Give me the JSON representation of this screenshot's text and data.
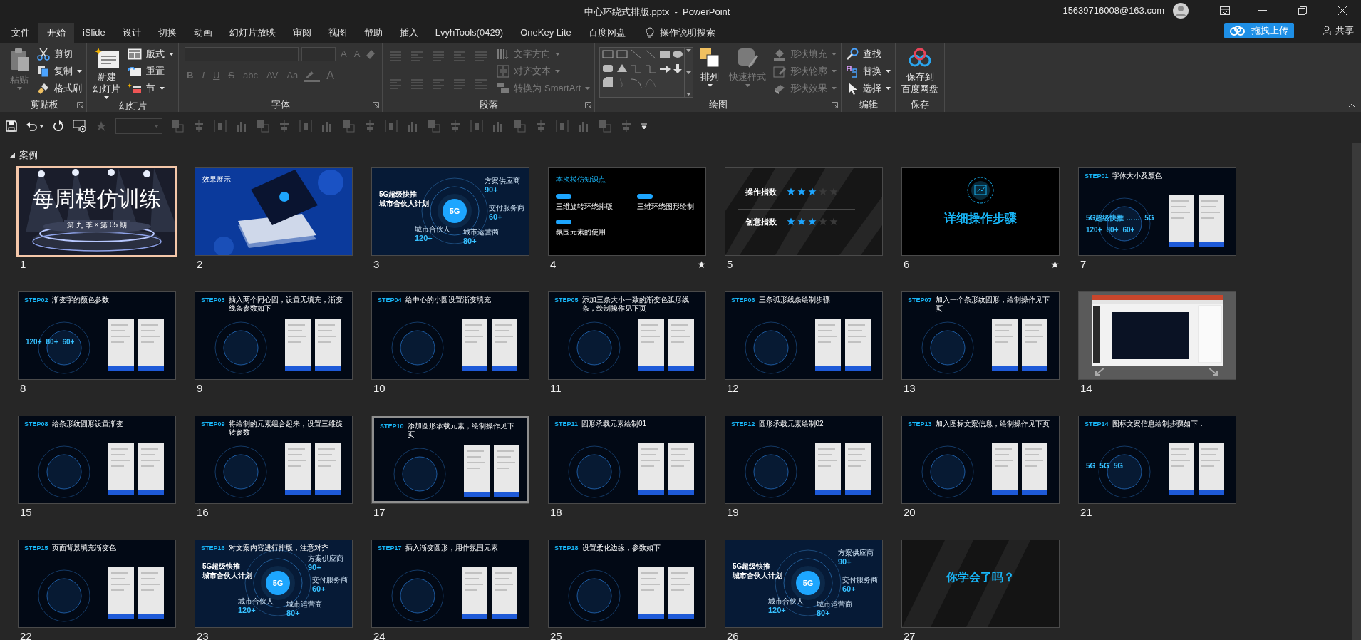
{
  "window": {
    "title": "中心环绕式排版.pptx  -  PowerPoint",
    "account": "15639716008@163.com"
  },
  "menu_tabs": [
    {
      "label": "文件",
      "selected": false
    },
    {
      "label": "开始",
      "selected": true
    },
    {
      "label": "iSlide",
      "selected": false
    },
    {
      "label": "设计",
      "selected": false
    },
    {
      "label": "切换",
      "selected": false
    },
    {
      "label": "动画",
      "selected": false
    },
    {
      "label": "幻灯片放映",
      "selected": false
    },
    {
      "label": "审阅",
      "selected": false
    },
    {
      "label": "视图",
      "selected": false
    },
    {
      "label": "帮助",
      "selected": false
    },
    {
      "label": "插入",
      "selected": false
    },
    {
      "label": "LvyhTools(0429)",
      "selected": false
    },
    {
      "label": "OneKey Lite",
      "selected": false
    },
    {
      "label": "百度网盘",
      "selected": false
    }
  ],
  "tell_me": "操作说明搜索",
  "upload_button": "拖拽上传",
  "share_button": "共享",
  "ribbon": [
    {
      "name": "剪贴板",
      "launcher": true,
      "items": [
        {
          "kind": "large",
          "label_lines": [
            "粘贴"
          ],
          "disabled": true,
          "dropdown": true
        },
        {
          "kind": "small",
          "label": "剪切",
          "disabled": false,
          "dropdown": false
        },
        {
          "kind": "small",
          "label": "复制",
          "disabled": false,
          "dropdown": true
        },
        {
          "kind": "small",
          "label": "格式刷",
          "disabled": false,
          "dropdown": false
        }
      ]
    },
    {
      "name": "幻灯片",
      "launcher": false,
      "items": [
        {
          "kind": "large",
          "label_lines": [
            "新建",
            "幻灯片"
          ],
          "disabled": false,
          "dropdown": true
        },
        {
          "kind": "small",
          "label": "版式",
          "disabled": false,
          "dropdown": true
        },
        {
          "kind": "small",
          "label": "重置",
          "disabled": false,
          "dropdown": false
        },
        {
          "kind": "small",
          "label": "节",
          "disabled": false,
          "dropdown": true
        }
      ]
    },
    {
      "name": "字体",
      "launcher": true,
      "items": [
        {
          "kind": "font_tools",
          "disabled": true,
          "top_buttons": [
            "A",
            "A"
          ],
          "buttons": [
            "B",
            "I",
            "U",
            "S",
            "abc",
            "AV",
            "Aa"
          ],
          "color_button": "A"
        }
      ]
    },
    {
      "name": "段落",
      "launcher": true,
      "items": [
        {
          "kind": "paragraph_tools",
          "disabled": true
        },
        {
          "kind": "small",
          "label": "文字方向",
          "disabled": true,
          "dropdown": true
        },
        {
          "kind": "small",
          "label": "对齐文本",
          "disabled": true,
          "dropdown": true
        },
        {
          "kind": "small",
          "label": "转换为 SmartArt",
          "disabled": true,
          "dropdown": true
        }
      ]
    },
    {
      "name": "绘图",
      "launcher": true,
      "items": [
        {
          "kind": "shape_gallery",
          "disabled": false
        },
        {
          "kind": "large",
          "label_lines": [
            "排列"
          ],
          "disabled": false,
          "dropdown": true
        },
        {
          "kind": "large",
          "label_lines": [
            "快速样式"
          ],
          "disabled": true,
          "dropdown": true
        },
        {
          "kind": "small",
          "label": "形状填充",
          "disabled": true,
          "dropdown": true
        },
        {
          "kind": "small",
          "label": "形状轮廓",
          "disabled": true,
          "dropdown": true
        },
        {
          "kind": "small",
          "label": "形状效果",
          "disabled": true,
          "dropdown": true
        }
      ]
    },
    {
      "name": "编辑",
      "launcher": false,
      "items": [
        {
          "kind": "small",
          "label": "查找",
          "disabled": false,
          "dropdown": false
        },
        {
          "kind": "small",
          "label": "替换",
          "disabled": false,
          "dropdown": true
        },
        {
          "kind": "small",
          "label": "选择",
          "disabled": false,
          "dropdown": true
        }
      ]
    },
    {
      "name": "保存",
      "launcher": false,
      "items": [
        {
          "kind": "large",
          "label_lines": [
            "保存到",
            "百度网盘"
          ],
          "disabled": false,
          "dropdown": false
        }
      ]
    }
  ],
  "section": {
    "name": "案例",
    "expanded": true
  },
  "slides": [
    {
      "number": "1",
      "selected": true,
      "focused": false,
      "animated": false,
      "kind": "cover",
      "title": "每周模仿训练",
      "subtitle": "第 九 季 × 第 05 期"
    },
    {
      "number": "2",
      "selected": false,
      "focused": false,
      "animated": false,
      "title": "效果展示"
    },
    {
      "number": "3",
      "selected": false,
      "focused": false,
      "animated": false,
      "kind": "hero",
      "title_lines": [
        "5G超级快推",
        "城市合伙人计划"
      ],
      "badge": "5G",
      "metrics": [
        {
          "label": "方案供应商",
          "value": "90+"
        },
        {
          "label": "交付服务商",
          "value": "60+"
        },
        {
          "label": "城市合伙人",
          "value": "120+"
        },
        {
          "label": "城市运营商",
          "value": "80+"
        }
      ]
    },
    {
      "number": "4",
      "selected": false,
      "focused": false,
      "animated": true,
      "kind": "points",
      "title": "本次模仿知识点",
      "points": [
        "三维旋转环绕排版",
        "三维环绕图形绘制",
        "氛围元素的使用"
      ]
    },
    {
      "number": "5",
      "selected": false,
      "focused": false,
      "animated": false,
      "kind": "rating",
      "ratings": [
        {
          "label": "操作指数",
          "stars": 3
        },
        {
          "label": "创意指数",
          "stars": 3
        }
      ]
    },
    {
      "number": "6",
      "selected": false,
      "focused": false,
      "animated": true,
      "kind": "section",
      "title": "详细操作步骤"
    },
    {
      "number": "7",
      "selected": false,
      "focused": false,
      "animated": false,
      "kind": "step",
      "step": "STEP01",
      "title": "字体大小及颜色",
      "texts": [
        "5G超级快推 ……",
        "5G",
        "120+",
        "80+",
        "60+"
      ]
    },
    {
      "number": "8",
      "selected": false,
      "focused": false,
      "animated": false,
      "kind": "step",
      "step": "STEP02",
      "title": "渐变字的颜色参数",
      "texts": [
        "120+",
        "80+",
        "60+"
      ]
    },
    {
      "number": "9",
      "selected": false,
      "focused": false,
      "animated": false,
      "kind": "step",
      "step": "STEP03",
      "title": "插入两个同心圆，设置无填充，渐变线条参数如下"
    },
    {
      "number": "10",
      "selected": false,
      "focused": false,
      "animated": false,
      "kind": "step",
      "step": "STEP04",
      "title": "给中心的小圆设置渐变填充"
    },
    {
      "number": "11",
      "selected": false,
      "focused": false,
      "animated": false,
      "kind": "step",
      "step": "STEP05",
      "title": "添加三条大小一致的渐变色弧形线条，绘制操作见下页"
    },
    {
      "number": "12",
      "selected": false,
      "focused": false,
      "animated": false,
      "kind": "step",
      "step": "STEP06",
      "title": "三条弧形线条绘制步骤"
    },
    {
      "number": "13",
      "selected": false,
      "focused": false,
      "animated": false,
      "kind": "step",
      "step": "STEP07",
      "title": "加入一个条形纹圆形，绘制操作见下页"
    },
    {
      "number": "14",
      "selected": false,
      "focused": false,
      "animated": false,
      "kind": "screenshot"
    },
    {
      "number": "15",
      "selected": false,
      "focused": false,
      "animated": false,
      "kind": "step",
      "step": "STEP08",
      "title": "给条形纹圆形设置渐变"
    },
    {
      "number": "16",
      "selected": false,
      "focused": false,
      "animated": false,
      "kind": "step",
      "step": "STEP09",
      "title": "将绘制的元素组合起来，设置三维旋转参数"
    },
    {
      "number": "17",
      "selected": false,
      "focused": true,
      "animated": false,
      "kind": "step",
      "step": "STEP10",
      "title": "添加圆形承载元素，绘制操作见下页"
    },
    {
      "number": "18",
      "selected": false,
      "focused": false,
      "animated": false,
      "kind": "step",
      "step": "STEP11",
      "title": "圆形承载元素绘制01"
    },
    {
      "number": "19",
      "selected": false,
      "focused": false,
      "animated": false,
      "kind": "step",
      "step": "STEP12",
      "title": "圆形承载元素绘制02"
    },
    {
      "number": "20",
      "selected": false,
      "focused": false,
      "animated": false,
      "kind": "step",
      "step": "STEP13",
      "title": "加入图标文案信息，绘制操作见下页"
    },
    {
      "number": "21",
      "selected": false,
      "focused": false,
      "animated": false,
      "kind": "step",
      "step": "STEP14",
      "title": "图标文案信息绘制步骤如下：",
      "texts": [
        "5G",
        "5G",
        "5G"
      ]
    },
    {
      "number": "22",
      "selected": false,
      "focused": false,
      "animated": false,
      "kind": "step",
      "step": "STEP15",
      "title": "页面背景填充渐变色"
    },
    {
      "number": "23",
      "selected": false,
      "focused": false,
      "animated": false,
      "kind": "hero",
      "step": "STEP16",
      "title": "对文案内容进行排版，注意对齐",
      "title_lines": [
        "5G超级快推",
        "城市合伙人计划"
      ],
      "badge": "5G",
      "metrics": [
        {
          "label": "方案供应商",
          "value": "90+"
        },
        {
          "label": "交付服务商",
          "value": "60+"
        },
        {
          "label": "城市合伙人",
          "value": "120+"
        },
        {
          "label": "城市运营商",
          "value": "80+"
        }
      ]
    },
    {
      "number": "24",
      "selected": false,
      "focused": false,
      "animated": false,
      "kind": "step",
      "step": "STEP17",
      "title": "插入渐变圆形，用作氛围元素"
    },
    {
      "number": "25",
      "selected": false,
      "focused": false,
      "animated": false,
      "kind": "step",
      "step": "STEP18",
      "title": "设置柔化边缘，参数如下"
    },
    {
      "number": "26",
      "selected": false,
      "focused": false,
      "animated": false,
      "kind": "hero",
      "title_lines": [
        "5G超级快推",
        "城市合伙人计划"
      ],
      "badge": "5G",
      "metrics": [
        {
          "label": "方案供应商",
          "value": "90+"
        },
        {
          "label": "交付服务商",
          "value": "60+"
        },
        {
          "label": "城市合伙人",
          "value": "120+"
        },
        {
          "label": "城市运营商",
          "value": "80+"
        }
      ]
    },
    {
      "number": "27",
      "selected": false,
      "focused": false,
      "animated": false,
      "kind": "ending",
      "title": "你学会了吗？"
    }
  ]
}
